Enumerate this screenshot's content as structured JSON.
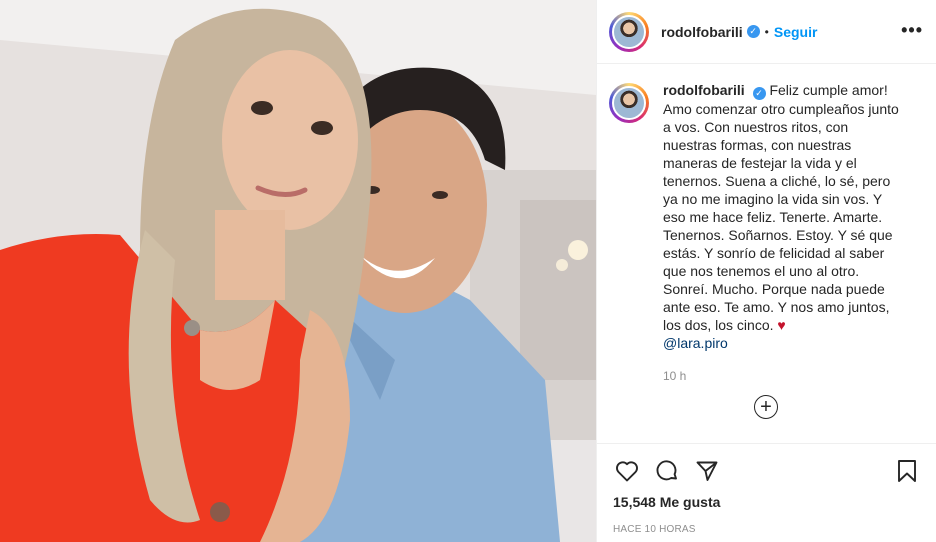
{
  "post": {
    "author": {
      "username": "rodolfobarili",
      "verified_icon": "verified-badge-icon",
      "follow_label": "Seguir"
    },
    "more_label": "•••",
    "caption": {
      "username": "rodolfobarili",
      "text": "Feliz cumple amor! Amo comenzar otro cumpleaños junto a vos. Con nuestros ritos, con nuestras formas, con nuestras maneras de festejar la vida y el tenernos. Suena a cliché, lo sé, pero ya no me imagino la vida sin vos. Y eso me hace feliz. Tenerte. Amarte. Tenernos. Soñarnos. Estoy. Y sé que estás. Y sonrío de felicidad al saber que nos tenemos el uno al otro. Sonreí. Mucho. Porque nada puede ante eso. Te amo. Y nos amo juntos, los dos, los cinco.",
      "heart": "♥",
      "mention": "@lara.piro",
      "time": "10 h"
    },
    "add_comment_label": "+",
    "likes": "15,548 Me gusta",
    "posted_ago": "HACE 10 HORAS"
  },
  "colors": {
    "link": "#0095f6",
    "verified": "#3897f0",
    "muted": "#8e8e8e",
    "text": "#262626"
  }
}
